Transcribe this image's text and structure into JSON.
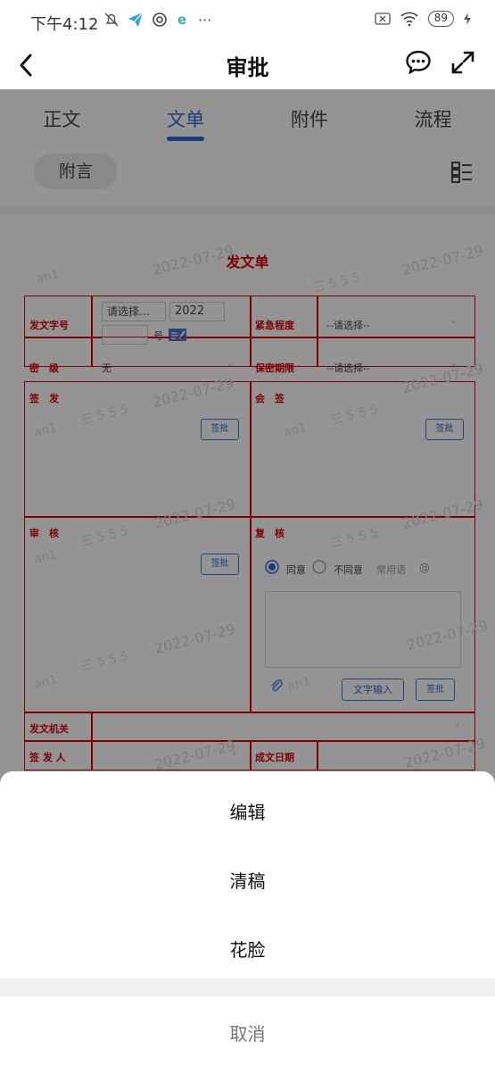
{
  "status": {
    "time": "下午4:12",
    "battery": "89"
  },
  "header": {
    "title": "审批",
    "back_icon": "chevron-left-icon",
    "chat_icon": "chat-icon",
    "expand_icon": "expand-icon"
  },
  "tabs": [
    {
      "label": "正文",
      "active": false
    },
    {
      "label": "文单",
      "active": true
    },
    {
      "label": "附件",
      "active": false
    },
    {
      "label": "流程",
      "active": false
    }
  ],
  "subbar": {
    "chip": "附言",
    "list_icon": "list-icon"
  },
  "form": {
    "title": "发文单",
    "watermark_date": "2022-07-29",
    "watermark_user": "an1",
    "watermark_marks": "三 5 5 5",
    "doc_number_label": "发文字号",
    "doc_number_select": "请选择...",
    "doc_number_year": "2022",
    "doc_number_suffix": "号",
    "urgency_label": "紧急程度",
    "urgency_value": "--请选择--",
    "secret_label": "密　级",
    "secret_value": "无",
    "secret_period_label": "保密期限",
    "secret_period_value": "--请选择--",
    "sign_label": "签　发",
    "countersign_label": "会　签",
    "review_label": "审　核",
    "recheck_label": "复　核",
    "approve_btn": "签批",
    "agree": "同意",
    "disagree": "不同意",
    "common_phrases": "常用语",
    "at": "@",
    "text_input_btn": "文字输入",
    "issuing_org_label": "发文机关",
    "signer_label": "签 发 人",
    "date_label": "成文日期"
  },
  "actions": {
    "edit": "编辑",
    "clean": "清稿",
    "face": "花脸",
    "cancel": "取消"
  },
  "colors": {
    "accent": "#2d6bd6",
    "form_red": "#dd0000"
  }
}
